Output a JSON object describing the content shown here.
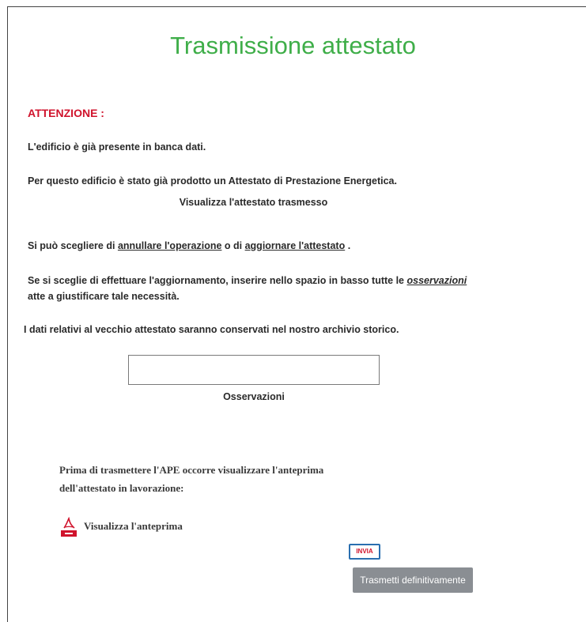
{
  "page": {
    "title": "Trasmissione attestato",
    "attention": "ATTENZIONE :",
    "line1": "L'edificio è già presente in banca dati.",
    "line2": "Per questo edificio è stato già prodotto un Attestato di Prestazione Energetica.",
    "view_sent_link": "Visualizza l'attestato trasmesso",
    "choice_prefix": "Si può scegliere di ",
    "choice_cancel": "annullare l'operazione",
    "choice_mid": " o di ",
    "choice_update": "aggiornare l'attestato",
    "choice_suffix": " .",
    "update_prefix": "Se si sceglie di effettuare l'aggiornamento, inserire nello spazio in basso tutte le ",
    "update_observations": "osservazioni",
    "update_line2": "atte a giustificare tale necessità.",
    "archive_note": "I dati relativi al vecchio attestato saranno conservati nel nostro archivio storico."
  },
  "observations": {
    "value": "",
    "label": "Osservazioni"
  },
  "preview": {
    "note_line1": "Prima di trasmettere l'APE occorre visualizzare l'anteprima",
    "note_line2": "dell'attestato in lavorazione:",
    "link": "Visualizza l'anteprima",
    "icon": "pdf-icon"
  },
  "actions": {
    "invia_badge": "INVIA",
    "send_button": "Trasmetti definitivamente"
  },
  "colors": {
    "title": "#3fae49",
    "attention": "#d0132c",
    "button_bg": "#8a8e93"
  }
}
